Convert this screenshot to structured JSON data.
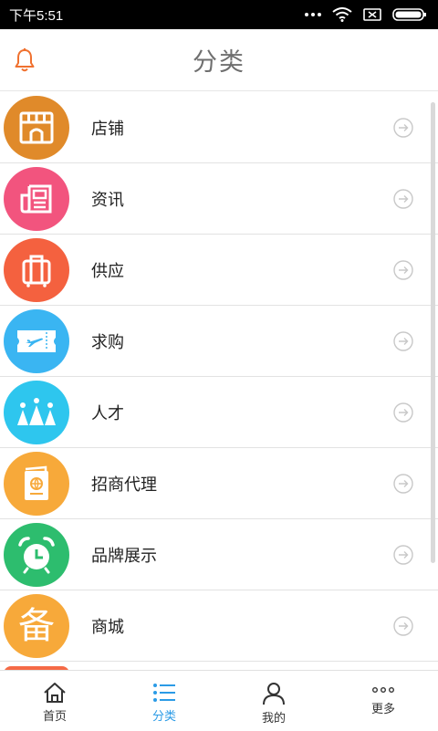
{
  "status_bar": {
    "time": "下午5:51"
  },
  "header": {
    "title": "分类"
  },
  "categories": [
    {
      "label": "店铺",
      "icon": "storefront-icon",
      "color": "#e08a2a"
    },
    {
      "label": "资讯",
      "icon": "newspaper-icon",
      "color": "#f2547e"
    },
    {
      "label": "供应",
      "icon": "luggage-icon",
      "color": "#f4613f"
    },
    {
      "label": "求购",
      "icon": "plane-ticket-icon",
      "color": "#3ab5f2"
    },
    {
      "label": "人才",
      "icon": "crown-people-icon",
      "color": "#2ec6ee"
    },
    {
      "label": "招商代理",
      "icon": "passport-icon",
      "color": "#f7a93a"
    },
    {
      "label": "品牌展示",
      "icon": "alarm-clock-icon",
      "color": "#2dbd6e"
    },
    {
      "label": "商城",
      "icon": "bei-character-icon",
      "color": "#f7a93a",
      "glyph": "备"
    }
  ],
  "tab_bar": {
    "active_color": "#2b9be6",
    "tabs": [
      {
        "label": "首页",
        "icon": "home-icon"
      },
      {
        "label": "分类",
        "icon": "list-icon",
        "active": true
      },
      {
        "label": "我的",
        "icon": "person-icon"
      },
      {
        "label": "更多",
        "icon": "more-dots-icon"
      }
    ]
  }
}
